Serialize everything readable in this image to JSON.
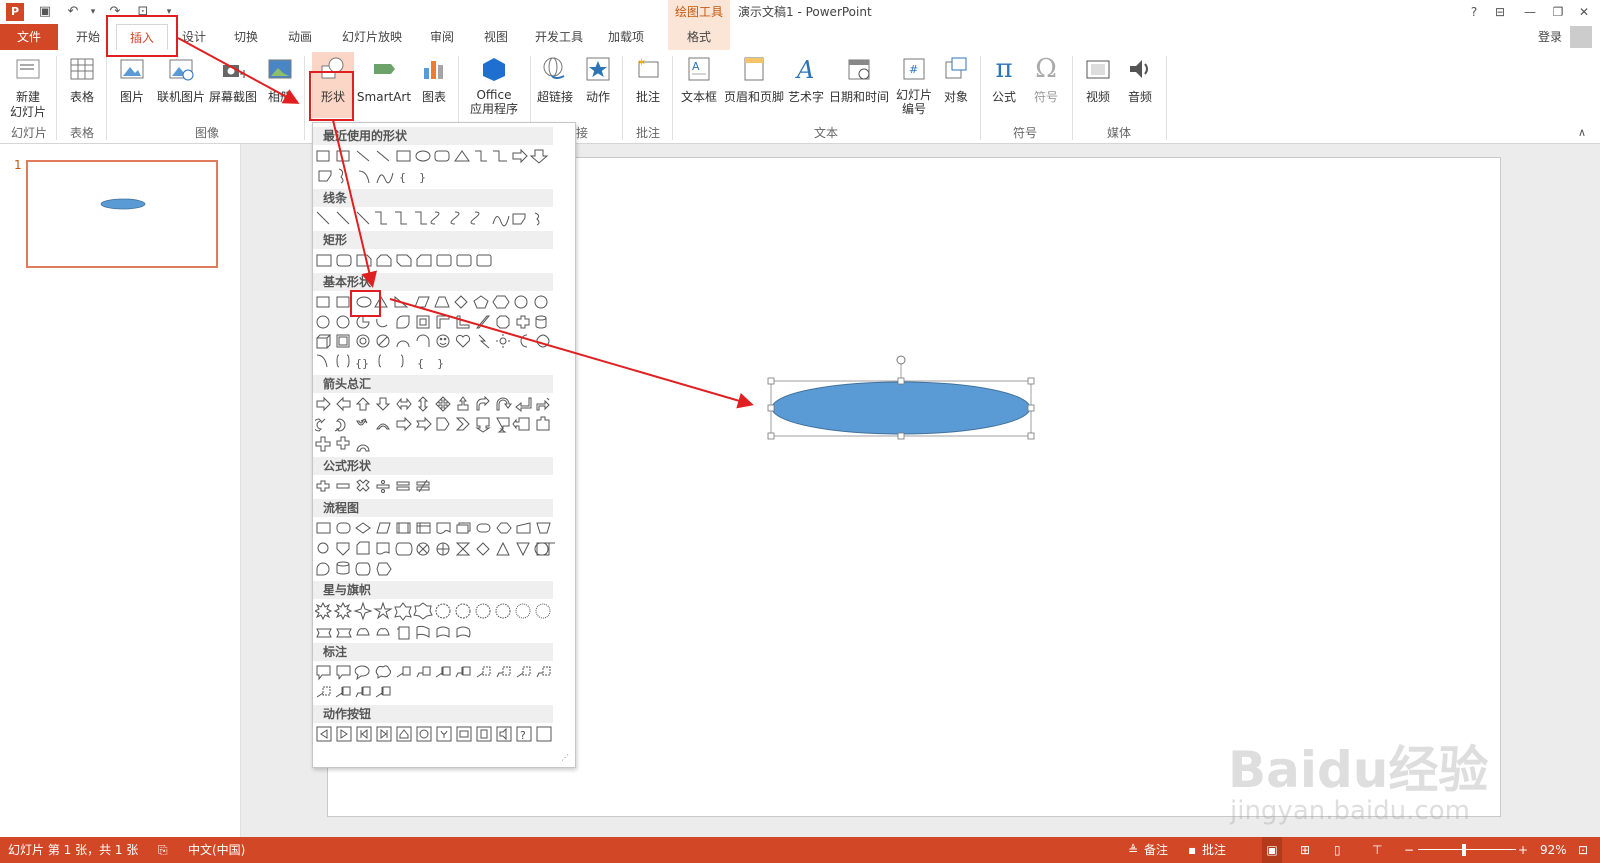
{
  "title_bar": {
    "context_label": "绘图工具",
    "window_title": "演示文稿1 - PowerPoint",
    "help": "?"
  },
  "tabs": [
    {
      "label": "文件"
    },
    {
      "label": "开始"
    },
    {
      "label": "插入"
    },
    {
      "label": "设计"
    },
    {
      "label": "切换"
    },
    {
      "label": "动画"
    },
    {
      "label": "幻灯片放映"
    },
    {
      "label": "审阅"
    },
    {
      "label": "视图"
    },
    {
      "label": "开发工具"
    },
    {
      "label": "加载项"
    },
    {
      "label": "格式"
    }
  ],
  "login": "登录",
  "ribbon": {
    "new_slide": "新建\n幻灯片",
    "table": "表格",
    "picture": "图片",
    "online_picture": "联机图片",
    "screenshot": "屏幕截图",
    "album": "相册",
    "shapes": "形状",
    "smartart": "SmartArt",
    "chart": "图表",
    "office_apps": "Office\n应用程序",
    "hyperlink": "超链接",
    "action": "动作",
    "comment": "批注",
    "textbox": "文本框",
    "header_footer": "页眉和页脚",
    "wordart": "艺术字",
    "datetime": "日期和时间",
    "slide_number": "幻灯片\n编号",
    "object": "对象",
    "equation": "公式",
    "symbol": "符号",
    "video": "视频",
    "audio": "音频",
    "groups": {
      "slides": "幻灯片",
      "tables": "表格",
      "images": "图像",
      "links": "接",
      "comments": "批注",
      "text": "文本",
      "symbols": "符号",
      "media": "媒体"
    }
  },
  "shapes_menu": {
    "categories": [
      "最近使用的形状",
      "线条",
      "矩形",
      "基本形状",
      "箭头总汇",
      "公式形状",
      "流程图",
      "星与旗帜",
      "标注",
      "动作按钮"
    ]
  },
  "slide_panel": {
    "slide_number": "1"
  },
  "status_bar": {
    "slide_info": "幻灯片 第 1 张，共 1 张",
    "language": "中文(中国)",
    "notes": "备注",
    "comments": "批注",
    "zoom": "92%"
  },
  "watermark": {
    "brand": "Baidu经验",
    "url": "jingyan.baidu.com"
  },
  "colors": {
    "accent": "#d24726",
    "shape_fill": "#5b9bd5",
    "annotation": "#e02020"
  }
}
